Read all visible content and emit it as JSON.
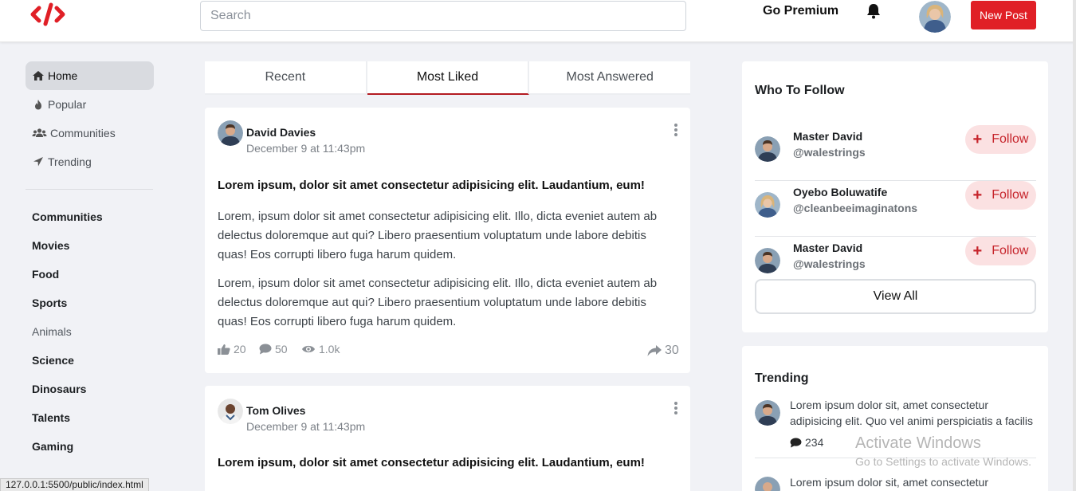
{
  "header": {
    "search_placeholder": "Search",
    "premium_label": "Go Premium",
    "new_post_label": "New Post",
    "brand_color": "#e01f26"
  },
  "sidebar": {
    "nav": [
      {
        "label": "Home",
        "icon": "home-icon",
        "active": true
      },
      {
        "label": "Popular",
        "icon": "fire-icon"
      },
      {
        "label": "Communities",
        "icon": "users-icon"
      },
      {
        "label": "Trending",
        "icon": "location-arrow-icon"
      }
    ],
    "categories": [
      "Communities",
      "Movies",
      "Food",
      "Sports",
      "Animals",
      "Science",
      "Dinosaurs",
      "Talents",
      "Gaming"
    ]
  },
  "tabs": [
    "Recent",
    "Most Liked",
    "Most Answered"
  ],
  "active_tab": "Most Liked",
  "posts": [
    {
      "author": "David Davies",
      "date": "December 9 at 11:43pm",
      "title": "Lorem ipsum, dolor sit amet consectetur adipisicing elit. Laudantium, eum!",
      "paragraphs": [
        "Lorem, ipsum dolor sit amet consectetur adipisicing elit. Illo, dicta eveniet autem ab delectus doloremque aut qui? Libero praesentium voluptatum unde labore debitis quas! Eos corrupti libero fuga harum quidem.",
        "Lorem, ipsum dolor sit amet consectetur adipisicing elit. Illo, dicta eveniet autem ab delectus doloremque aut qui? Libero praesentium voluptatum unde labore debitis quas! Eos corrupti libero fuga harum quidem."
      ],
      "likes": "20",
      "comments": "50",
      "views": "1.0k",
      "shares": "30"
    },
    {
      "author": "Tom Olives",
      "date": "December 9 at 11:43pm",
      "title": "Lorem ipsum, dolor sit amet consectetur adipisicing elit. Laudantium, eum!"
    }
  ],
  "who_to_follow": {
    "title": "Who To Follow",
    "follow_label": "Follow",
    "users": [
      {
        "name": "Master David",
        "handle": "@walestrings"
      },
      {
        "name": "Oyebo Boluwatife",
        "handle": "@cleanbeeimaginatons"
      },
      {
        "name": "Master David",
        "handle": "@walestrings"
      }
    ],
    "view_all_label": "View All"
  },
  "trending": {
    "title": "Trending",
    "items": [
      {
        "text": "Lorem ipsum dolor sit, amet consectetur adipisicing elit. Quo vel animi perspiciatis a facilis",
        "count": "234"
      },
      {
        "text": "Lorem ipsum dolor sit, amet consectetur"
      }
    ]
  },
  "overlay": {
    "activate_title": "Activate Windows",
    "activate_sub": "Go to Settings to activate Windows.",
    "status_url": "127.0.0.1:5500/public/index.html"
  }
}
